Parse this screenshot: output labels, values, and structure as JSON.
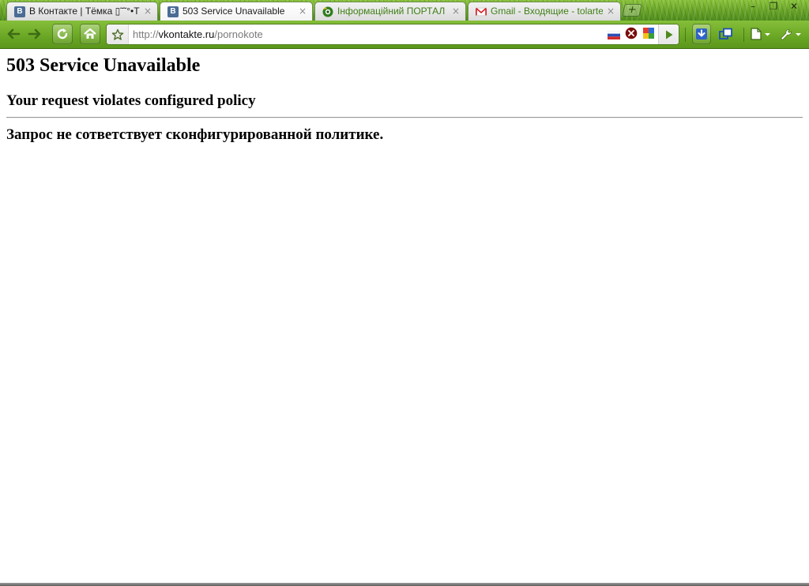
{
  "browser": {
    "tabs": [
      {
        "title": "В Контакте | Тёмка ▯˜˜°•Т▯...",
        "favicon": "vk-icon",
        "active": false,
        "close": "×"
      },
      {
        "title": "503 Service Unavailable",
        "favicon": "vk-icon",
        "active": true,
        "close": "×"
      },
      {
        "title": "Інформаційний ПОРТАЛ ...",
        "favicon": "portal-icon",
        "active": false,
        "close": "×"
      },
      {
        "title": "Gmail - Входящие - tolartem...",
        "favicon": "gmail-icon",
        "active": false,
        "close": "×"
      }
    ],
    "new_tab_label": "+",
    "window_controls": {
      "minimize": "–",
      "maximize": "❐",
      "close": "✕"
    },
    "address": {
      "scheme": "http://",
      "host": "vkontakte.ru",
      "path": "/pornokote"
    },
    "vk_badge_letter": "B"
  },
  "page": {
    "title": "503 Service Unavailable",
    "message_en": "Your request violates configured policy",
    "message_ru": "Запрос не сответствует сконфигурированной политике."
  },
  "colors": {
    "theme_green": "#6aa624",
    "vk_blue": "#4a6c95",
    "text": "#000000"
  }
}
